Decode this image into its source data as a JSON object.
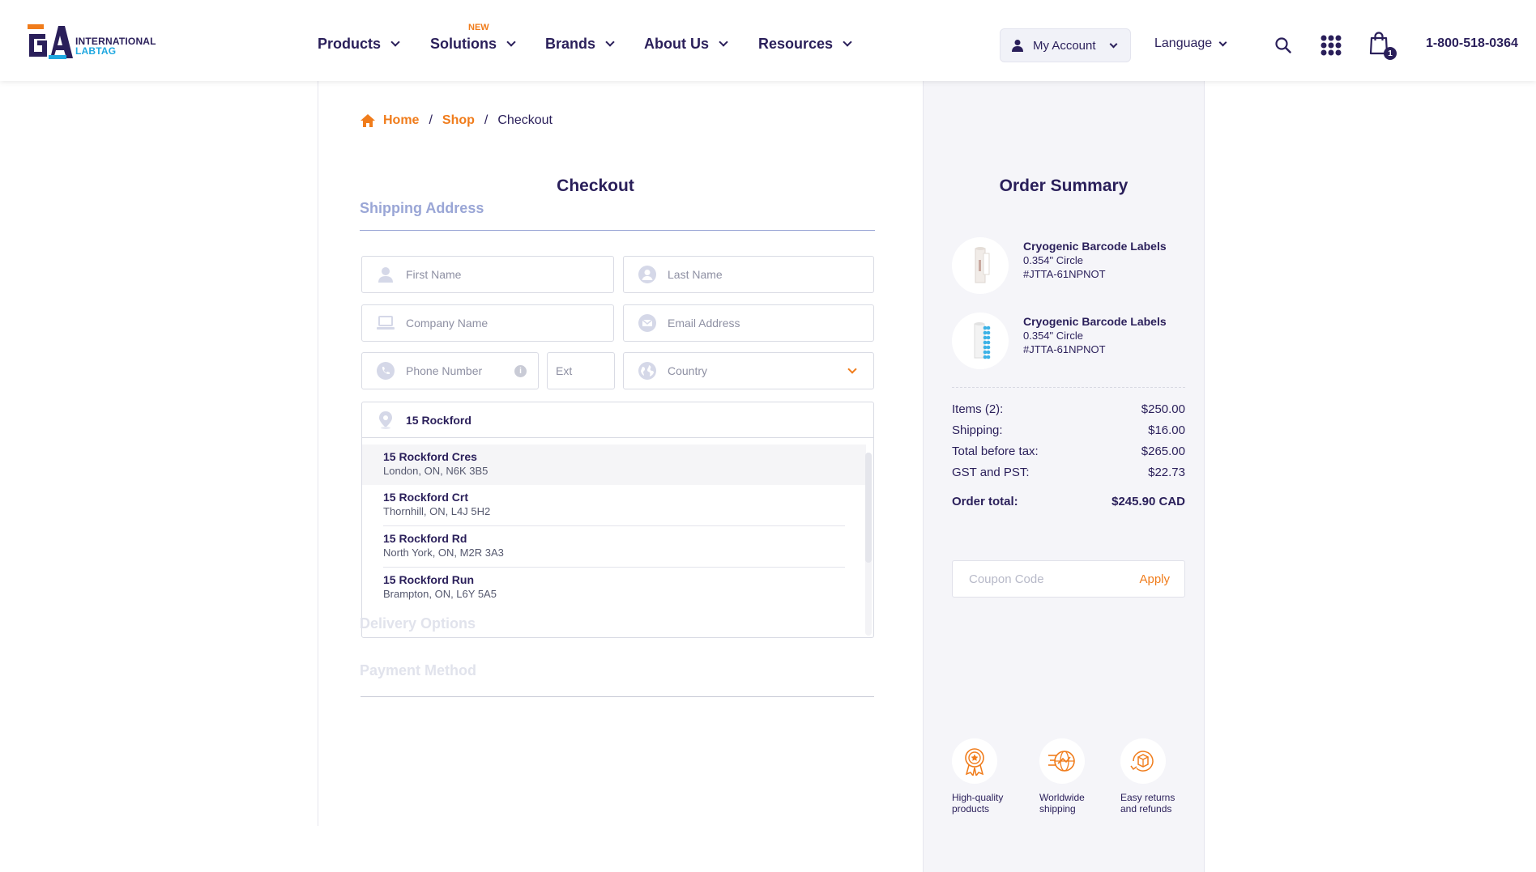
{
  "header": {
    "logo_line1": "INTERNATIONAL",
    "logo_line2": "LABTAG",
    "nav": [
      {
        "label": "Products"
      },
      {
        "label": "Solutions",
        "badge": "NEW"
      },
      {
        "label": "Brands"
      },
      {
        "label": "About Us"
      },
      {
        "label": "Resources"
      }
    ],
    "account_label": "My Account",
    "language_label": "Language",
    "cart_count": "1",
    "phone": "1-800-518-0364",
    "icons": [
      "user-icon",
      "search-icon",
      "grid-icon",
      "shopping-bag-icon",
      "home-icon"
    ]
  },
  "breadcrumb": {
    "home": "Home",
    "shop": "Shop",
    "current": "Checkout",
    "separator": "/"
  },
  "checkout": {
    "title": "Checkout",
    "shipping_section": "Shipping Address",
    "fields": {
      "first_name": "First Name",
      "last_name": "Last Name",
      "company": "Company Name",
      "email": "Email Address",
      "phone": "Phone Number",
      "ext": "Ext",
      "country": "Country"
    },
    "address_value": "15 Rockford",
    "suggestions": [
      {
        "street": "15 Rockford Cres",
        "city": "London, ON, N6K 3B5"
      },
      {
        "street": "15 Rockford Crt",
        "city": "Thornhill, ON, L4J 5H2"
      },
      {
        "street": "15 Rockford Rd",
        "city": "North York, ON, M2R 3A3"
      },
      {
        "street": "15 Rockford Run",
        "city": "Brampton, ON, L6Y 5A5"
      }
    ],
    "delivery_section": "Delivery Options",
    "payment_section": "Payment Method"
  },
  "summary": {
    "title": "Order Summary",
    "products": [
      {
        "name": "Cryogenic Barcode Labels",
        "size": "0.354\" Circle",
        "sku": "#JTTA-61NPNOT"
      },
      {
        "name": "Cryogenic Barcode Labels",
        "size": "0.354\" Circle",
        "sku": "#JTTA-61NPNOT"
      }
    ],
    "lines": [
      {
        "label": "Items (2):",
        "value": "$250.00"
      },
      {
        "label": "Shipping:",
        "value": "$16.00"
      },
      {
        "label": "Total before tax:",
        "value": "$265.00"
      },
      {
        "label": "GST and PST:",
        "value": "$22.73"
      }
    ],
    "total_label": "Order total:",
    "total_value": "$245.90 CAD",
    "coupon_placeholder": "Coupon Code",
    "coupon_apply": "Apply",
    "features": [
      {
        "line1": "High-quality",
        "line2": "products"
      },
      {
        "line1": "Worldwide",
        "line2": "shipping"
      },
      {
        "line1": "Easy returns",
        "line2": "and refunds"
      }
    ]
  },
  "colors": {
    "brand_navy": "#2a1f5a",
    "accent_orange": "#f07c1b",
    "accent_blue": "#1fa8e0",
    "muted_blue": "#9aa6d6"
  }
}
